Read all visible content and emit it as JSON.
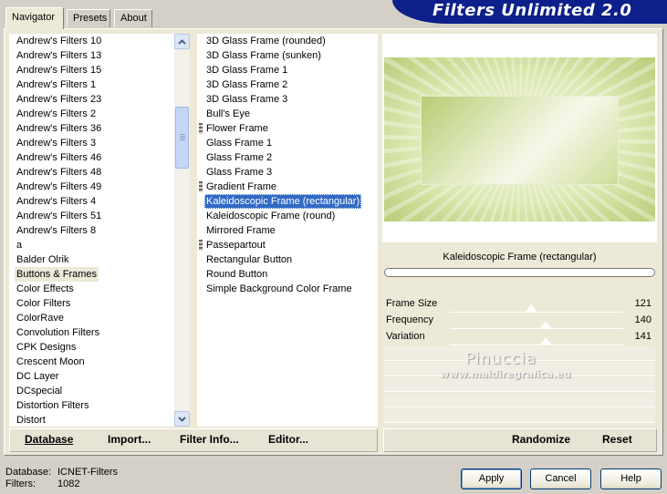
{
  "tabs": [
    {
      "label": "Navigator",
      "active": true
    },
    {
      "label": "Presets",
      "active": false
    },
    {
      "label": "About",
      "active": false
    }
  ],
  "banner_title": "Filters Unlimited 2.0",
  "categories": [
    "Andrew's Filters 10",
    "Andrew's Filters 13",
    "Andrew's Filters 15",
    "Andrew's Filters 1",
    "Andrew's Filters 23",
    "Andrew's Filters 2",
    "Andrew's Filters 36",
    "Andrew's Filters 3",
    "Andrew's Filters 46",
    "Andrew's Filters 48",
    "Andrew's Filters 49",
    "Andrew's Filters 4",
    "Andrew's Filters 51",
    "Andrew's Filters 8",
    "a",
    "Balder Olrik",
    "Buttons & Frames",
    "Color Effects",
    "Color Filters",
    "ColorRave",
    "Convolution Filters",
    "CPK Designs",
    "Crescent Moon",
    "DC Layer",
    "DCspecial",
    "Distortion Filters",
    "Distort"
  ],
  "selected_category": "Buttons & Frames",
  "filters": [
    {
      "label": "3D Glass Frame (rounded)",
      "marker": false
    },
    {
      "label": "3D Glass Frame (sunken)",
      "marker": false
    },
    {
      "label": "3D Glass Frame 1",
      "marker": false
    },
    {
      "label": "3D Glass Frame 2",
      "marker": false
    },
    {
      "label": "3D Glass Frame 3",
      "marker": false
    },
    {
      "label": "Bull's Eye",
      "marker": false
    },
    {
      "label": "Flower Frame",
      "marker": true
    },
    {
      "label": "Glass Frame 1",
      "marker": false
    },
    {
      "label": "Glass Frame 2",
      "marker": false
    },
    {
      "label": "Glass Frame 3",
      "marker": false
    },
    {
      "label": "Gradient Frame",
      "marker": true
    },
    {
      "label": "Kaleidoscopic Frame (rectangular)",
      "marker": false
    },
    {
      "label": "Kaleidoscopic Frame (round)",
      "marker": false
    },
    {
      "label": "Mirrored Frame",
      "marker": false
    },
    {
      "label": "Passepartout",
      "marker": true
    },
    {
      "label": "Rectangular Button",
      "marker": false
    },
    {
      "label": "Round Button",
      "marker": false
    },
    {
      "label": "Simple Background Color Frame",
      "marker": false
    }
  ],
  "selected_filter": "Kaleidoscopic Frame (rectangular)",
  "filter_title": "Kaleidoscopic Frame (rectangular)",
  "params": [
    {
      "label": "Frame Size",
      "value": "121",
      "level": 0.47
    },
    {
      "label": "Frequency",
      "value": "140",
      "level": 0.55
    },
    {
      "label": "Variation",
      "value": "141",
      "level": 0.55
    }
  ],
  "watermark": {
    "name": "Pinuccia",
    "url": "www.maidiregrafica.eu"
  },
  "bottom_left_buttons": [
    "Database",
    "Import...",
    "Filter Info...",
    "Editor..."
  ],
  "bottom_right_buttons": [
    "Randomize",
    "Reset"
  ],
  "status": {
    "database_label": "Database:",
    "database_value": "ICNET-Filters",
    "filters_label": "Filters:",
    "filters_value": "1082"
  },
  "dialog_buttons": {
    "apply": "Apply",
    "cancel": "Cancel",
    "help": "Help"
  },
  "colors": {
    "banner": "#0d1f8a",
    "selection": "#316ac5",
    "panel": "#ece9d8",
    "preview_green": "#c5d68a"
  }
}
